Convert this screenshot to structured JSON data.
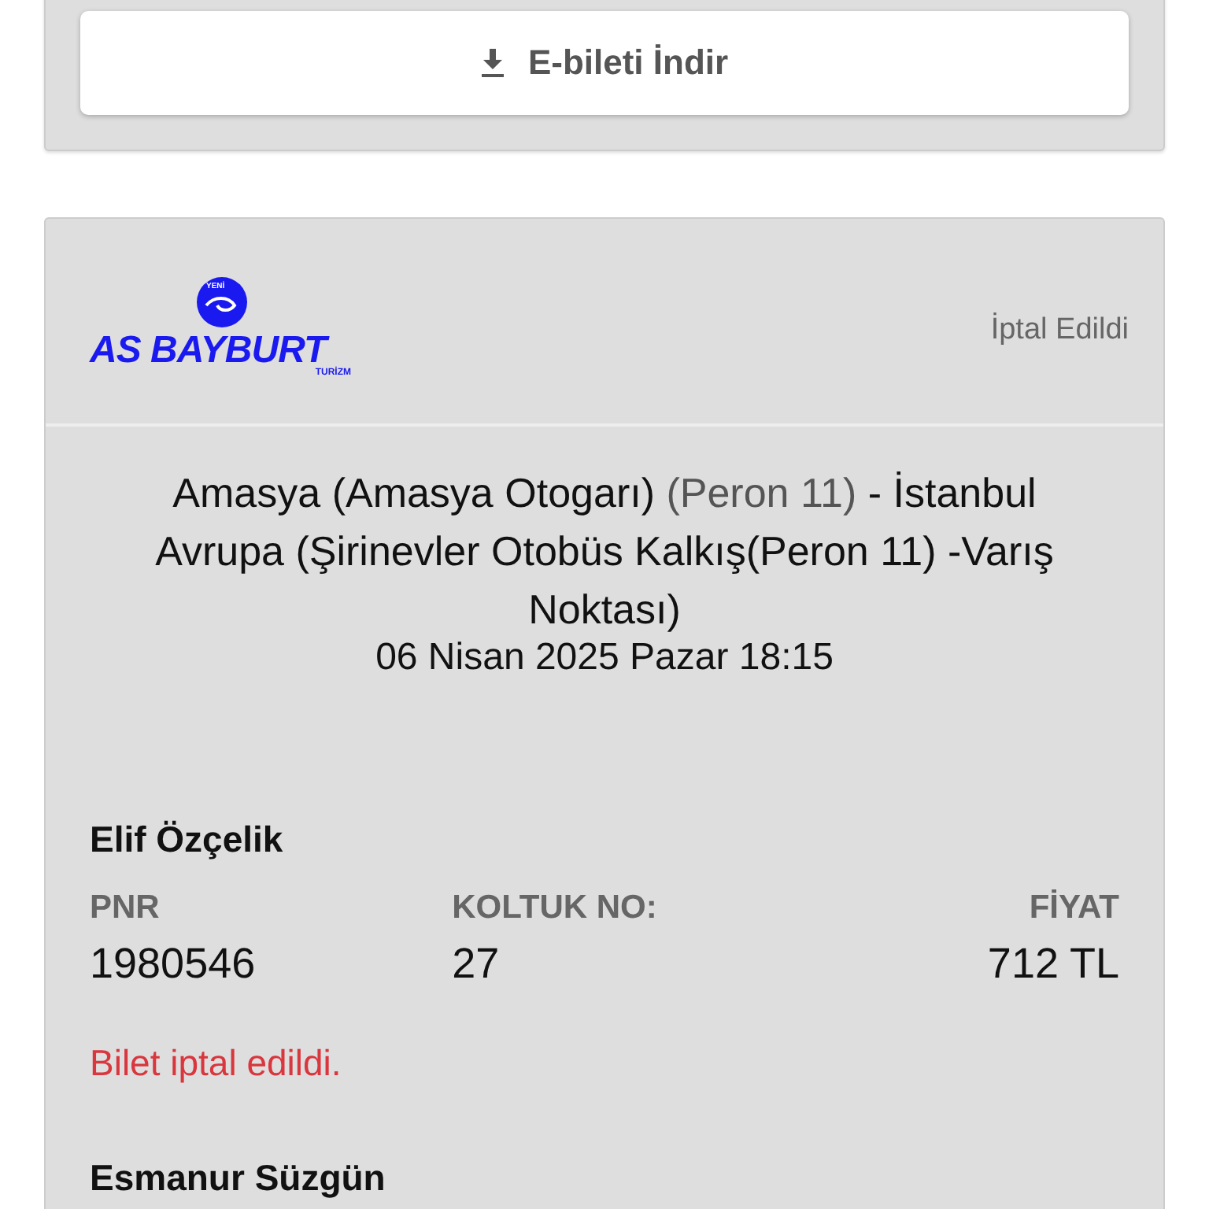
{
  "download_button": {
    "label": "E-bileti İndir"
  },
  "ticket": {
    "logo": {
      "top": "YENİ",
      "name": "AS BAYBURT",
      "sub": "TURİZM"
    },
    "status": "İptal Edildi",
    "route": [
      {
        "text": "Amasya (Amasya Otogarı) ",
        "light": false
      },
      {
        "text": "(Peron 11)",
        "light": true
      },
      {
        "text": " - İstanbul Avrupa (Şirinevler Otobüs Kalkış(Peron 11) -Varış Noktası)",
        "light": false
      }
    ],
    "date": "06 Nisan 2025 Pazar 18:15",
    "passengers": [
      {
        "name": "Elif Özçelik",
        "fields": [
          {
            "label": "PNR",
            "value": "1980546"
          },
          {
            "label": "KOLTUK NO:",
            "value": "27"
          },
          {
            "label": "FİYAT",
            "value": "712 TL"
          }
        ],
        "note": "Bilet iptal edildi.",
        "cancelled": true
      },
      {
        "name": "Esmanur Süzgün"
      }
    ]
  }
}
